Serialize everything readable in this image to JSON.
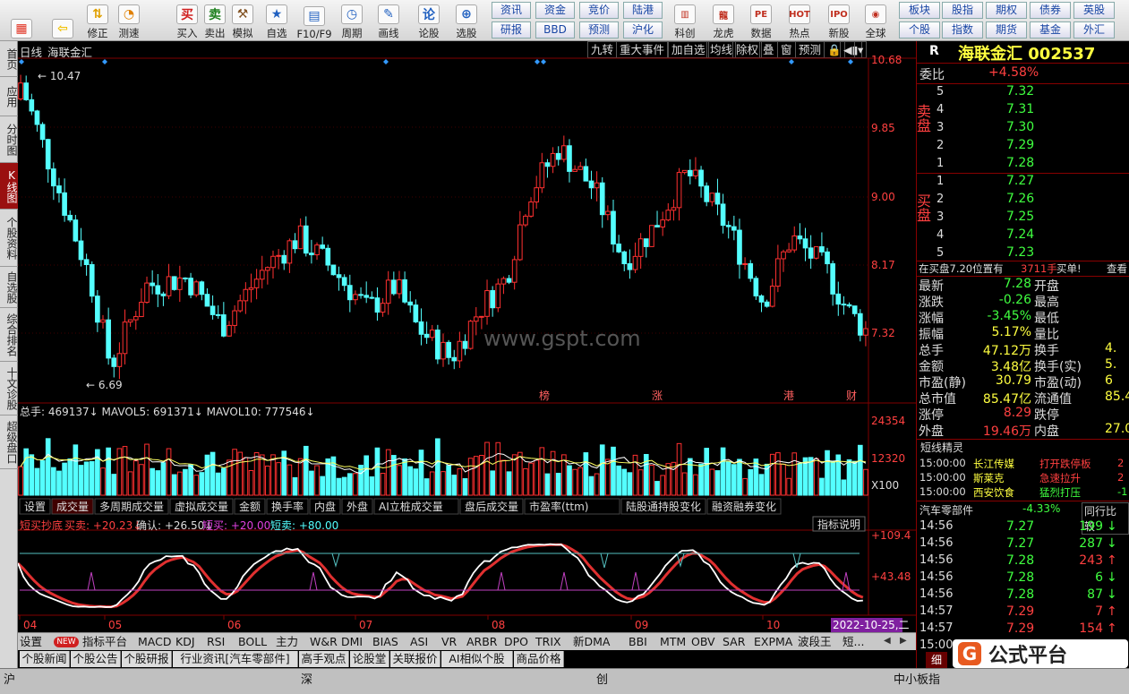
{
  "toolbar": {
    "buttons": [
      {
        "label": "",
        "icon": "windows-icon",
        "color": "#e03020"
      },
      {
        "label": "",
        "icon": "back-arrow-icon",
        "color": "#f0c000"
      },
      {
        "label": "修正",
        "icon": "up-down-icon",
        "color": "#e0a000"
      },
      {
        "label": "测速",
        "icon": "stopwatch-icon",
        "color": "#e08000"
      },
      {
        "label": "买入",
        "icon": "buy-icon",
        "glyph": "买",
        "color": "#d02020"
      },
      {
        "label": "卖出",
        "icon": "sell-icon",
        "glyph": "卖",
        "color": "#208020"
      },
      {
        "label": "模拟",
        "icon": "hammer-icon",
        "color": "#805020"
      },
      {
        "label": "自选",
        "icon": "star-icon",
        "color": "#2060c0"
      },
      {
        "label": "F10/F9",
        "icon": "f10-icon",
        "color": "#2060c0"
      },
      {
        "label": "周期",
        "icon": "clock-icon",
        "color": "#2060c0"
      },
      {
        "label": "画线",
        "icon": "pencil-icon",
        "color": "#2060c0"
      },
      {
        "label": "论股",
        "icon": "lun-icon",
        "glyph": "论",
        "color": "#2060c0"
      },
      {
        "label": "选股",
        "icon": "magnifier-chart-icon",
        "color": "#2060c0"
      }
    ],
    "grid1": [
      "资讯",
      "资金",
      "竞价",
      "陆港"
    ],
    "grid2": [
      "研报",
      "BBD",
      "预测",
      "沪化"
    ],
    "buttons2": [
      {
        "label": "科创",
        "icon": "chart-icon"
      },
      {
        "label": "龙虎",
        "icon": "dragon-icon"
      },
      {
        "label": "数据",
        "icon": "pe-icon",
        "glyph": "PE"
      },
      {
        "label": "热点",
        "icon": "hot-icon",
        "glyph": "HOT"
      },
      {
        "label": "新股",
        "icon": "ipo-icon",
        "glyph": "IPO"
      },
      {
        "label": "全球",
        "icon": "globe-icon"
      }
    ],
    "grid3": [
      "板块",
      "股指",
      "期权",
      "债券",
      "英股"
    ],
    "grid4": [
      "个股",
      "指数",
      "期货",
      "基金",
      "外汇"
    ]
  },
  "sidebar": [
    "首页",
    "应用",
    "分时图",
    "K线图",
    "个股资料",
    "自选股",
    "综合排名",
    "十文诊股",
    "超级盘口"
  ],
  "chart": {
    "period": "日线",
    "name": "海联金汇",
    "toolbar": [
      "九转",
      "重大事件",
      "加自选",
      "均线",
      "除权",
      "叠",
      "窗",
      "预测"
    ],
    "yticks": [
      "10.68",
      "9.85",
      "9.00",
      "8.17",
      "7.32"
    ],
    "hi_label": "10.47",
    "lo_label": "6.69",
    "markers": [
      "榜",
      "涨",
      "港",
      "财"
    ],
    "watermark": "www.gspt.com",
    "vol": {
      "label": "总手: 469137↓ MAVOL5: 691371↓ MAVOL10: 777546↓",
      "ticks": [
        "24354",
        "12320",
        "X100"
      ]
    },
    "tabs": [
      "设置",
      "成交量",
      "多周期成交量",
      "虚拟成交量",
      "金额",
      "换手率",
      "内盘",
      "外盘",
      "AI立桩成交量",
      "盘后成交量",
      "市盈率(ttm)",
      "陆股通持股变化",
      "融资融券变化"
    ],
    "ind": {
      "label_a": "短买抄底",
      "label_b": "买卖: +20.23↓",
      "label_c": "确认: +26.50↓",
      "label_d": "短买: +20.00",
      "label_e": "短卖: +80.00",
      "help": "指标说明",
      "ticks": [
        "+109.4",
        "+43.48"
      ]
    },
    "months": [
      "04",
      "05",
      "06",
      "07",
      "08",
      "09",
      "10"
    ],
    "date": "2022-10-25,二"
  },
  "indicator_tabs": [
    "设置",
    "NEW",
    "指标平台",
    "MACD",
    "KDJ",
    "RSI",
    "BOLL",
    "主力",
    "W&R",
    "DMI",
    "BIAS",
    "ASI",
    "VR",
    "ARBR",
    "DPO",
    "TRIX",
    "新DMA",
    "BBI",
    "MTM",
    "OBV",
    "SAR",
    "EXPMA",
    "波段王",
    "短..."
  ],
  "news_tabs": [
    "个股新闻",
    "个股公告",
    "个股研报",
    "行业资讯[汽车零部件]",
    "高手观点",
    "论股堂",
    "关联报价",
    "AI相似个股",
    "商品价格"
  ],
  "status": [
    "沪",
    "深",
    "创",
    "中小板指"
  ],
  "right": {
    "title": "海联金汇 002537",
    "r": "R",
    "weibi_label": "委比",
    "weibi": "+4.58%",
    "sell_label": "卖盘",
    "buy_label": "买盘",
    "sells": [
      [
        "5",
        "7.32"
      ],
      [
        "4",
        "7.31"
      ],
      [
        "3",
        "7.30"
      ],
      [
        "2",
        "7.29"
      ],
      [
        "1",
        "7.28"
      ]
    ],
    "buys": [
      [
        "1",
        "7.27"
      ],
      [
        "2",
        "7.26"
      ],
      [
        "3",
        "7.25"
      ],
      [
        "4",
        "7.24"
      ],
      [
        "5",
        "7.23"
      ]
    ],
    "info_line": "在买盘7.20位置有",
    "info_vol": "3711手",
    "info_tail": "买单!",
    "info_look": "查看",
    "quote": [
      [
        "最新",
        "7.28",
        "开盘",
        ""
      ],
      [
        "涨跌",
        "-0.26",
        "最高",
        ""
      ],
      [
        "涨幅",
        "-3.45%",
        "最低",
        ""
      ],
      [
        "振幅",
        "5.17%",
        "量比",
        ""
      ],
      [
        "总手",
        "47.12万",
        "换手",
        "4."
      ],
      [
        "金额",
        "3.48亿",
        "换手(实)",
        "5."
      ],
      [
        "市盈(静)",
        "30.79",
        "市盈(动)",
        "6"
      ],
      [
        "总市值",
        "85.47亿",
        "流通值",
        "85.4"
      ],
      [
        "涨停",
        "8.29",
        "跌停",
        ""
      ],
      [
        "外盘",
        "19.46万",
        "内盘",
        "27.0"
      ]
    ],
    "jingling": "短线精灵",
    "events": [
      [
        "15:00:00",
        "长江传媒",
        "打开跌停板",
        "2"
      ],
      [
        "15:00:00",
        "斯莱克",
        "急速拉升",
        "2"
      ],
      [
        "15:00:00",
        "西安饮食",
        "猛烈打压",
        "-1"
      ]
    ],
    "sector": "汽车零部件",
    "sector_chg": "-4.33%",
    "sector_tail": "同行比较",
    "ticks": [
      [
        "14:56",
        "7.27",
        "199",
        "down"
      ],
      [
        "14:56",
        "7.27",
        "287",
        "down"
      ],
      [
        "14:56",
        "7.28",
        "243",
        "up"
      ],
      [
        "14:56",
        "7.28",
        "6",
        "down"
      ],
      [
        "14:56",
        "7.28",
        "87",
        "down"
      ],
      [
        "14:57",
        "7.29",
        "7",
        "up"
      ],
      [
        "14:57",
        "7.29",
        "154",
        "up"
      ],
      [
        "15:00",
        "",
        "",
        " "
      ]
    ],
    "bottom_tab": "细"
  },
  "brand": {
    "text": "公式平台"
  },
  "colors": {
    "up": "#ff3030",
    "down": "#54ffff",
    "yellow": "#ffff00",
    "green": "#40ff40"
  }
}
